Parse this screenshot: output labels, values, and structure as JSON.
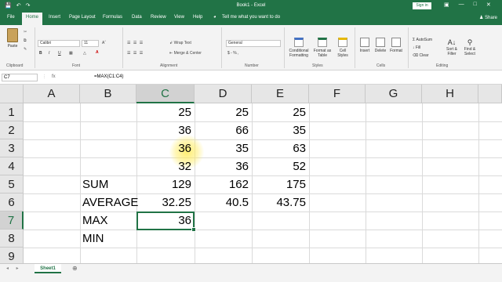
{
  "window": {
    "title": "Book1 - Excel",
    "sign_in": "Sign in",
    "qat": {
      "save": "💾",
      "undo": "↶",
      "redo": "↷"
    },
    "controls": {
      "ribbon_options": "▣",
      "minimize": "—",
      "maximize": "□",
      "close": "✕"
    }
  },
  "tabs": [
    "File",
    "Home",
    "Insert",
    "Page Layout",
    "Formulas",
    "Data",
    "Review",
    "View",
    "Help"
  ],
  "tell_me": "Tell me what you want to do",
  "share": "Share",
  "ribbon": {
    "clipboard": {
      "paste": "Paste",
      "label": "Clipboard"
    },
    "font": {
      "name": "Calibri",
      "size": "11",
      "label": "Font",
      "bold": "B",
      "italic": "I",
      "underline": "U"
    },
    "alignment": {
      "wrap_text": "Wrap Text",
      "merge_center": "Merge & Center",
      "label": "Alignment"
    },
    "number": {
      "format": "General",
      "currency": "$ - % ,",
      "label": "Number"
    },
    "styles": {
      "conditional": "Conditional Formatting",
      "format_table": "Format as Table",
      "cell_styles": "Cell Styles",
      "label": "Styles"
    },
    "cells": {
      "insert": "Insert",
      "delete": "Delete",
      "format": "Format",
      "label": "Cells"
    },
    "editing": {
      "autosum": "AutoSum",
      "fill": "Fill",
      "clear": "Clear",
      "sort_filter": "Sort & Filter",
      "find_select": "Find & Select",
      "label": "Editing"
    }
  },
  "formula_bar": {
    "name_box": "C7",
    "fx": "fx",
    "formula": "=MAX(C1:C4)"
  },
  "grid": {
    "columns": [
      "A",
      "B",
      "C",
      "D",
      "E",
      "F",
      "G",
      "H"
    ],
    "rows": [
      "1",
      "2",
      "3",
      "4",
      "5",
      "6",
      "7",
      "8",
      "9"
    ],
    "selected_column": "C",
    "selected_row": "7",
    "cells": {
      "C1": "25",
      "D1": "25",
      "E1": "25",
      "C2": "36",
      "D2": "66",
      "E2": "35",
      "C3": "36",
      "D3": "35",
      "E3": "63",
      "C4": "32",
      "D4": "36",
      "E4": "52",
      "B5": "SUM",
      "C5": "129",
      "D5": "162",
      "E5": "175",
      "B6": "AVERAGE",
      "C6": "32.25",
      "D6": "40.5",
      "E6": "43.75",
      "B7": "MAX",
      "C7": "36",
      "B8": "MIN"
    }
  },
  "sheets": {
    "active": "Sheet1",
    "add": "⊕",
    "nav": "◂ ▸"
  },
  "colors": {
    "accent": "#217346"
  }
}
